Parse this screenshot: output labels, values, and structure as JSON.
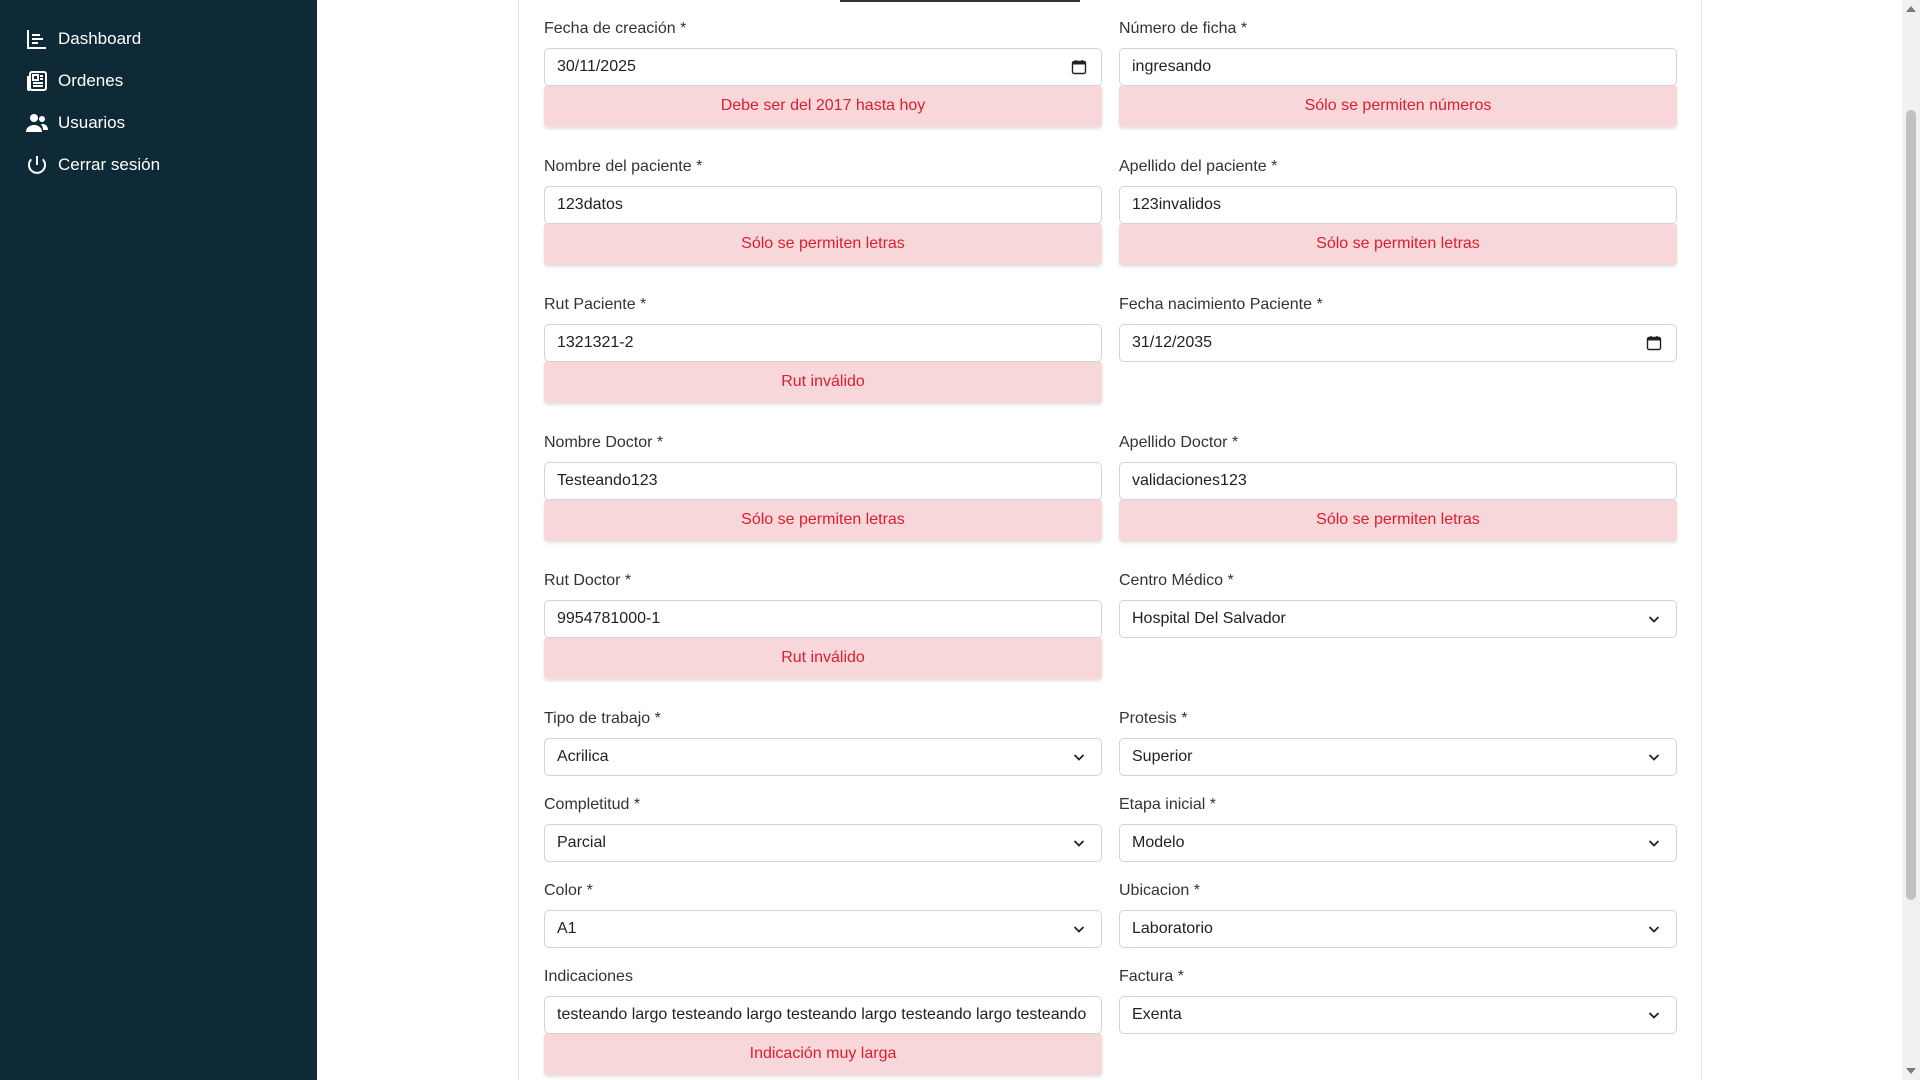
{
  "sidebar": {
    "items": [
      {
        "label": "Dashboard",
        "icon": "dashboard-icon"
      },
      {
        "label": "Ordenes",
        "icon": "orders-icon"
      },
      {
        "label": "Usuarios",
        "icon": "users-icon"
      },
      {
        "label": "Cerrar sesión",
        "icon": "power-icon"
      }
    ]
  },
  "colors": {
    "sidebar_bg": "#0d2a36",
    "error_bg": "#f8d7da",
    "error_text": "#dc1e2e",
    "input_border": "#cfd4da"
  },
  "form": {
    "fecha_creacion": {
      "label": "Fecha de creación *",
      "value": "30/11/2025",
      "error": "Debe ser del 2017 hasta hoy"
    },
    "numero_ficha": {
      "label": "Número de ficha *",
      "value": "ingresando",
      "error": "Sólo se permiten números"
    },
    "nombre_paciente": {
      "label": "Nombre del paciente *",
      "value": "123datos",
      "error": "Sólo se permiten letras"
    },
    "apellido_paciente": {
      "label": "Apellido del paciente *",
      "value": "123invalidos",
      "error": "Sólo se permiten letras"
    },
    "rut_paciente": {
      "label": "Rut Paciente *",
      "value": "1321321-2",
      "error": "Rut inválido"
    },
    "fecha_nacimiento": {
      "label": "Fecha nacimiento Paciente *",
      "value": "31/12/2035"
    },
    "nombre_doctor": {
      "label": "Nombre Doctor *",
      "value": "Testeando123",
      "error": "Sólo se permiten letras"
    },
    "apellido_doctor": {
      "label": "Apellido Doctor *",
      "value": "validaciones123",
      "error": "Sólo se permiten letras"
    },
    "rut_doctor": {
      "label": "Rut Doctor *",
      "value": "9954781000-1",
      "error": "Rut inválido"
    },
    "centro_medico": {
      "label": "Centro Médico *",
      "value": "Hospital Del Salvador"
    },
    "tipo_trabajo": {
      "label": "Tipo de trabajo *",
      "value": "Acrilica"
    },
    "protesis": {
      "label": "Protesis *",
      "value": "Superior"
    },
    "completitud": {
      "label": "Completitud *",
      "value": "Parcial"
    },
    "etapa_inicial": {
      "label": "Etapa inicial *",
      "value": "Modelo"
    },
    "color": {
      "label": "Color *",
      "value": "A1"
    },
    "ubicacion": {
      "label": "Ubicacion *",
      "value": "Laboratorio"
    },
    "indicaciones": {
      "label": "Indicaciones",
      "value": "testeando largo testeando largo testeando largo testeando largo testeando",
      "error": "Indicación muy larga"
    },
    "factura": {
      "label": "Factura *",
      "value": "Exenta"
    }
  }
}
